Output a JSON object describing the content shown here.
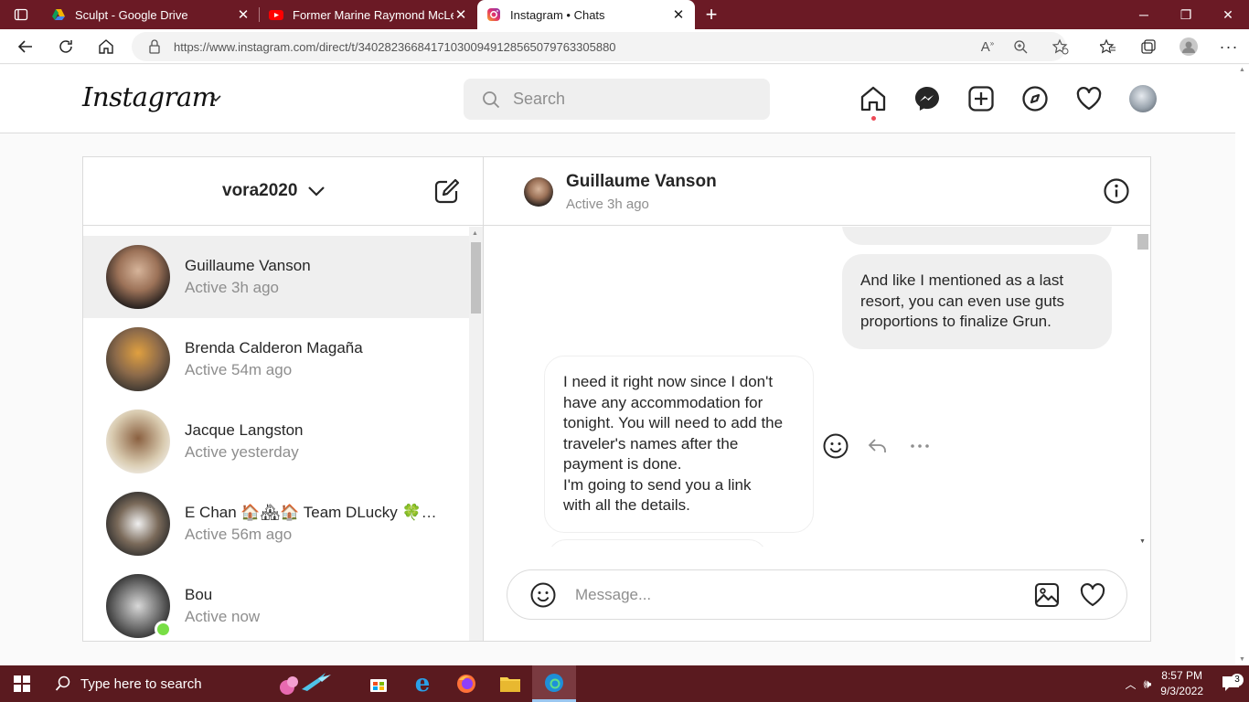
{
  "browser": {
    "tabs": [
      {
        "title": "Sculpt - Google Drive",
        "favicon": "google-drive-icon",
        "active": false
      },
      {
        "title": "Former Marine Raymond McLeod",
        "favicon": "youtube-icon",
        "active": false
      },
      {
        "title": "Instagram • Chats",
        "favicon": "instagram-icon",
        "active": true
      }
    ],
    "url": "https://www.instagram.com/direct/t/340282366841710300949128565079763305880"
  },
  "header": {
    "logo": "Instagram",
    "search_placeholder": "Search"
  },
  "inbox": {
    "account": "vora2020",
    "conversations": [
      {
        "name": "Guillaume Vanson",
        "status": "Active 3h ago",
        "selected": true,
        "online": false
      },
      {
        "name": "Brenda Calderon Magaña",
        "status": "Active 54m ago",
        "selected": false,
        "online": false
      },
      {
        "name": "Jacque Langston",
        "status": "Active yesterday",
        "selected": false,
        "online": false
      },
      {
        "name": "E Chan 🏠🏘🏠 Team DLucky 🍀…",
        "status": "Active 56m ago",
        "selected": false,
        "online": false
      },
      {
        "name": "Bou",
        "status": "Active now",
        "selected": false,
        "online": true
      }
    ]
  },
  "chat": {
    "name": "Guillaume Vanson",
    "status": "Active 3h ago",
    "messages": [
      {
        "from": "me",
        "lines": [
          "And like I mentioned as a last",
          "resort, you can even use guts",
          "proportions to finalize Grun."
        ]
      },
      {
        "from": "them",
        "lines": [
          "I need it right now since I don't",
          "have any accommodation for",
          "tonight. You will need to add the",
          "traveler's names after the",
          "payment is done.",
          "I'm going to send you a link",
          "with all the details."
        ]
      }
    ],
    "composer_placeholder": "Message..."
  },
  "taskbar": {
    "search_placeholder": "Type here to search",
    "time": "8:57 PM",
    "date": "9/3/2022",
    "notification_count": "3"
  },
  "colors": {
    "tabstrip": "#6b1a25",
    "taskbar": "#5a1a1f",
    "online": "#78de45",
    "notif_dot": "#ed4956"
  }
}
